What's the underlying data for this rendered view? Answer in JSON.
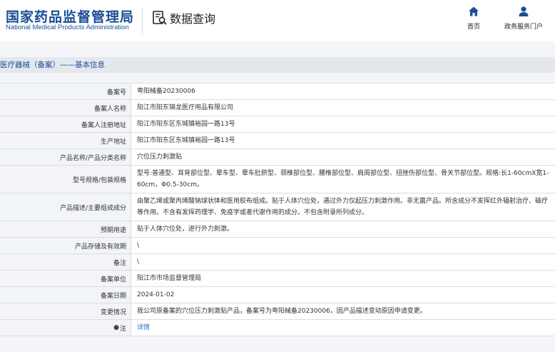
{
  "header": {
    "logo_cn": "国家药品监督管理局",
    "logo_en": "National Medical Products Administration",
    "query_title": "数据查询",
    "nav": [
      {
        "label": "首页",
        "icon": "home-icon"
      },
      {
        "label": "政务服务门户",
        "icon": "user-icon"
      }
    ]
  },
  "breadcrumb": "医疗器械（备案）——基本信息",
  "rows": [
    {
      "label": "备案号",
      "value": "粤阳械备20230006"
    },
    {
      "label": "备案人名称",
      "value": "阳江市阳东锦龙医疗用品有限公司"
    },
    {
      "label": "备案人注册地址",
      "value": "阳江市阳东区东城镇裕园一路13号"
    },
    {
      "label": "生产地址",
      "value": "阳江市阳东区东城镇裕园一路13号"
    },
    {
      "label": "产品名称/产品分类名称",
      "value": "穴位压力刺激贴"
    },
    {
      "label": "型号规格/包装规格",
      "value": "型号:普通型、耳背部位型、晕车型、晕车肚脐型、颈椎部位型、腰椎部位型、肩周部位型、扭挫伤部位型、骨关节部位型。规格:长1-60cmX宽1-60cm，Φ0.5-30cm。"
    },
    {
      "label": "产品描述/主要组成成分",
      "value": "由聚乙烯或聚丙烯酸钠球状体和医用胶布组成。贴于人体穴位处，通过外力仅起压力刺激作用。非无菌产品。所含成分不发挥红外辐射治疗、磁疗等作用。不含有发挥药理学、免疫学或者代谢作用的成分。不包含附录所列成分。"
    },
    {
      "label": "预期用途",
      "value": "贴于人体穴位处，进行外力刺激。"
    },
    {
      "label": "产品存储及有效期",
      "value": "\\"
    },
    {
      "label": "备注",
      "value": "\\"
    },
    {
      "label": "备案单位",
      "value": "阳江市市场监督管理局"
    },
    {
      "label": "备案日期",
      "value": "2024-01-02"
    },
    {
      "label": "变更情况",
      "value": "我公司原备案的穴位压力刺激贴产品，备案号为粤阳械备20230006，因产品描述变动原因申请变更。"
    },
    {
      "label": "注",
      "value": "详情",
      "pin": "●"
    }
  ],
  "colors": {
    "brand": "#1a4e95",
    "link": "#1a6cc7"
  }
}
